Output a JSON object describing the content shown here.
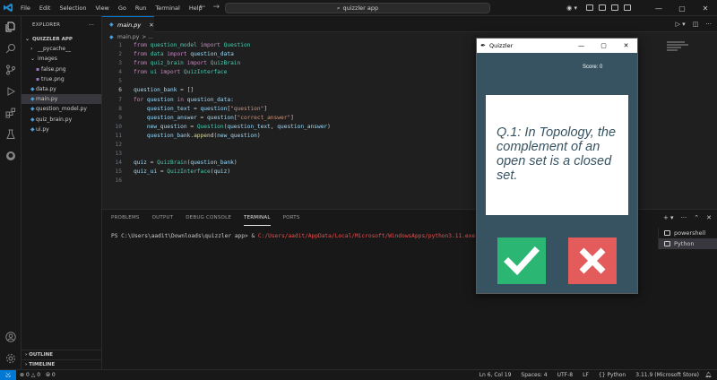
{
  "menu": [
    "File",
    "Edit",
    "Selection",
    "View",
    "Go",
    "Run",
    "Terminal",
    "Help"
  ],
  "search": {
    "text": "quizzler app"
  },
  "sidebar": {
    "header": "EXPLORER",
    "folder": "QUIZZLER APP",
    "items": [
      {
        "label": "__pycache__",
        "kind": "folder-collapsed"
      },
      {
        "label": "images",
        "kind": "folder-open"
      },
      {
        "label": "false.png",
        "kind": "png"
      },
      {
        "label": "true.png",
        "kind": "png"
      },
      {
        "label": "data.py",
        "kind": "py"
      },
      {
        "label": "main.py",
        "kind": "py"
      },
      {
        "label": "question_model.py",
        "kind": "py"
      },
      {
        "label": "quiz_brain.py",
        "kind": "py"
      },
      {
        "label": "ui.py",
        "kind": "py"
      }
    ],
    "outline": "OUTLINE",
    "timeline": "TIMELINE"
  },
  "editor": {
    "tab": "main.py",
    "breadcrumb_file": "main.py",
    "breadcrumb_rest": "> ...",
    "line_numbers": [
      "1",
      "2",
      "3",
      "4",
      "5",
      "6",
      "7",
      "8",
      "9",
      "10",
      "11",
      "12",
      "13",
      "14",
      "15",
      "16"
    ]
  },
  "panel": {
    "tabs": [
      "PROBLEMS",
      "OUTPUT",
      "DEBUG CONSOLE",
      "TERMINAL",
      "PORTS"
    ],
    "prompt": "PS C:\\Users\\aadit\\Downloads\\quizzler app> &",
    "command": "C:/Users/aadit/AppData/Local/Microsoft/WindowsApps/python3.11.exe",
    "terminals": [
      "powershell",
      "Python"
    ]
  },
  "status": {
    "errors": "0",
    "warnings": "0",
    "ports": "0",
    "cursor": "Ln 6, Col 19",
    "spaces": "Spaces: 4",
    "encoding": "UTF-8",
    "eol": "LF",
    "language": "Python",
    "interpreter": "3.11.9 (Microsoft Store)"
  },
  "quiz": {
    "title": "Quizzler",
    "score": "Score: 0",
    "question": "Q.1: In Topology, the complement of an open set is a closed set.",
    "true_color": "#2bb673",
    "false_color": "#e35b5b",
    "bg_color": "#375362"
  }
}
